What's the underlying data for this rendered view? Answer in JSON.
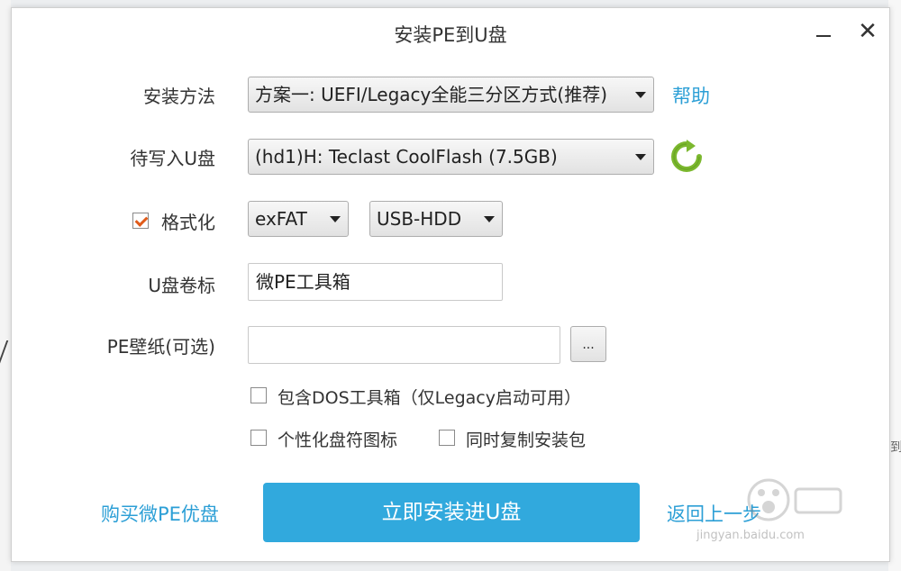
{
  "window": {
    "title": "安装PE到U盘",
    "minimize_glyph": "—",
    "close_glyph": "✕"
  },
  "install_method": {
    "label": "安装方法",
    "value": "方案一:  UEFI/Legacy全能三分区方式(推荐)",
    "help_link": "帮助"
  },
  "target_disk": {
    "label": "待写入U盘",
    "value": "(hd1)H: Teclast CoolFlash (7.5GB)",
    "refresh_icon": "refresh-icon"
  },
  "format": {
    "label": "格式化",
    "checked": true,
    "filesystem": "exFAT",
    "mode": "USB-HDD"
  },
  "volume_label": {
    "label": "U盘卷标",
    "value": "微PE工具箱"
  },
  "wallpaper": {
    "label": "PE壁纸(可选)",
    "value": "",
    "browse_label": "..."
  },
  "options": {
    "include_dos": "包含DOS工具箱（仅Legacy启动可用）",
    "custom_icon": "个性化盘符图标",
    "copy_package": "同时复制安装包"
  },
  "footer": {
    "buy_link": "购买微PE优盘",
    "install_button": "立即安装进U盘",
    "back_link": "返回上一步"
  },
  "watermark": {
    "text": "jingyan.baidu.com"
  },
  "colors": {
    "accent": "#31a9dd",
    "link": "#2c9fd6",
    "check": "#e05b1a",
    "refresh": "#7cb82f"
  }
}
